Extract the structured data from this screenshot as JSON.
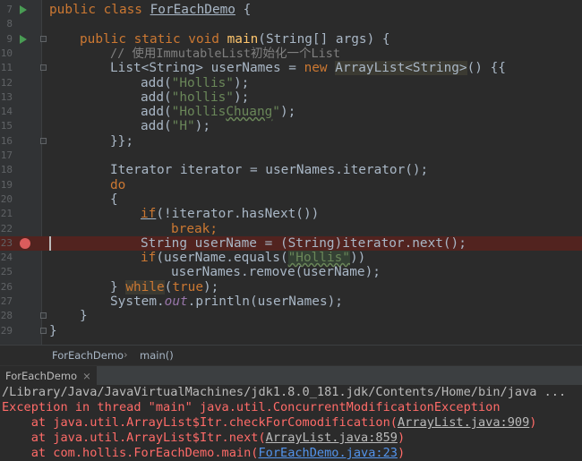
{
  "editor": {
    "line_numbers": [
      "7",
      "8",
      "9",
      "10",
      "11",
      "12",
      "13",
      "14",
      "15",
      "16",
      "17",
      "18",
      "19",
      "20",
      "21",
      "22",
      "23",
      "24",
      "25",
      "26",
      "27",
      "28",
      "29"
    ],
    "line7": {
      "kw": "public class",
      "name": "ForEachDemo",
      "brace": "{"
    },
    "line9": {
      "kw": "public static void",
      "fn": "main",
      "rest": "(String[] args) {"
    },
    "line10": {
      "comment": "// 使用ImmutableList初始化一个List"
    },
    "line11": {
      "a": "List<String> userNames = ",
      "kw": "new",
      "type": "ArrayList<String>",
      "b": "() {{"
    },
    "line12": {
      "a": "add(",
      "s": "\"Hollis\"",
      "b": ");"
    },
    "line13": {
      "a": "add(",
      "s": "\"hollis\"",
      "b": ");"
    },
    "line14": {
      "a": "add(",
      "s1": "\"Hollis",
      "s2": "Chuang",
      "s3": "\"",
      "b": ");"
    },
    "line15": {
      "a": "add(",
      "s": "\"H\"",
      "b": ");"
    },
    "line16": {
      "a": "}};"
    },
    "line18": {
      "a": "Iterator iterator = userNames.iterator();"
    },
    "line19": {
      "kw": "do"
    },
    "line20": {
      "a": "{"
    },
    "line21": {
      "kw": "if",
      "a": "(!iterator.hasNext())"
    },
    "line22": {
      "kw": "break",
      "a": ";"
    },
    "line23": {
      "a": "String userName = (String)iterator.next();"
    },
    "line24": {
      "kw": "if",
      "a": "(userName.equals(",
      "s": "\"Hollis\"",
      "b": "))"
    },
    "line25": {
      "a": "userNames.remove(userName);"
    },
    "line26": {
      "a": "} ",
      "kw1": "while",
      "b": "(",
      "kw2": "true",
      "c": ");"
    },
    "line27": {
      "a": "System.",
      "st": "out",
      "b": ".println(userNames);"
    },
    "line28": {
      "a": "}"
    },
    "line29": {
      "a": "}"
    }
  },
  "breadcrumb": {
    "class": "ForEachDemo",
    "separator": "›",
    "method": "main()"
  },
  "run_panel": {
    "tab_label": "ForEachDemo",
    "close": "×",
    "lines": {
      "path": "/Library/Java/JavaVirtualMachines/jdk1.8.0_181.jdk/Contents/Home/bin/java ...",
      "exception": "Exception in thread \"main\" java.util.ConcurrentModificationException",
      "frame1_pre": "    at java.util.ArrayList$Itr.checkForComodification(",
      "frame1_link": "ArrayList.java:909",
      "frame1_post": ")",
      "frame2_pre": "    at java.util.ArrayList$Itr.next(",
      "frame2_link": "ArrayList.java:859",
      "frame2_post": ")",
      "frame3_pre": "    at com.hollis.ForEachDemo.main(",
      "frame3_link": "ForEachDemo.java:23",
      "frame3_post": ")"
    }
  },
  "colors": {
    "background": "#2b2b2b",
    "keyword": "#cc7832",
    "string": "#6a8759",
    "method": "#ffc66d",
    "error": "#ff6b68",
    "link": "#5394ec",
    "breakpoint": "#db5c5c"
  }
}
